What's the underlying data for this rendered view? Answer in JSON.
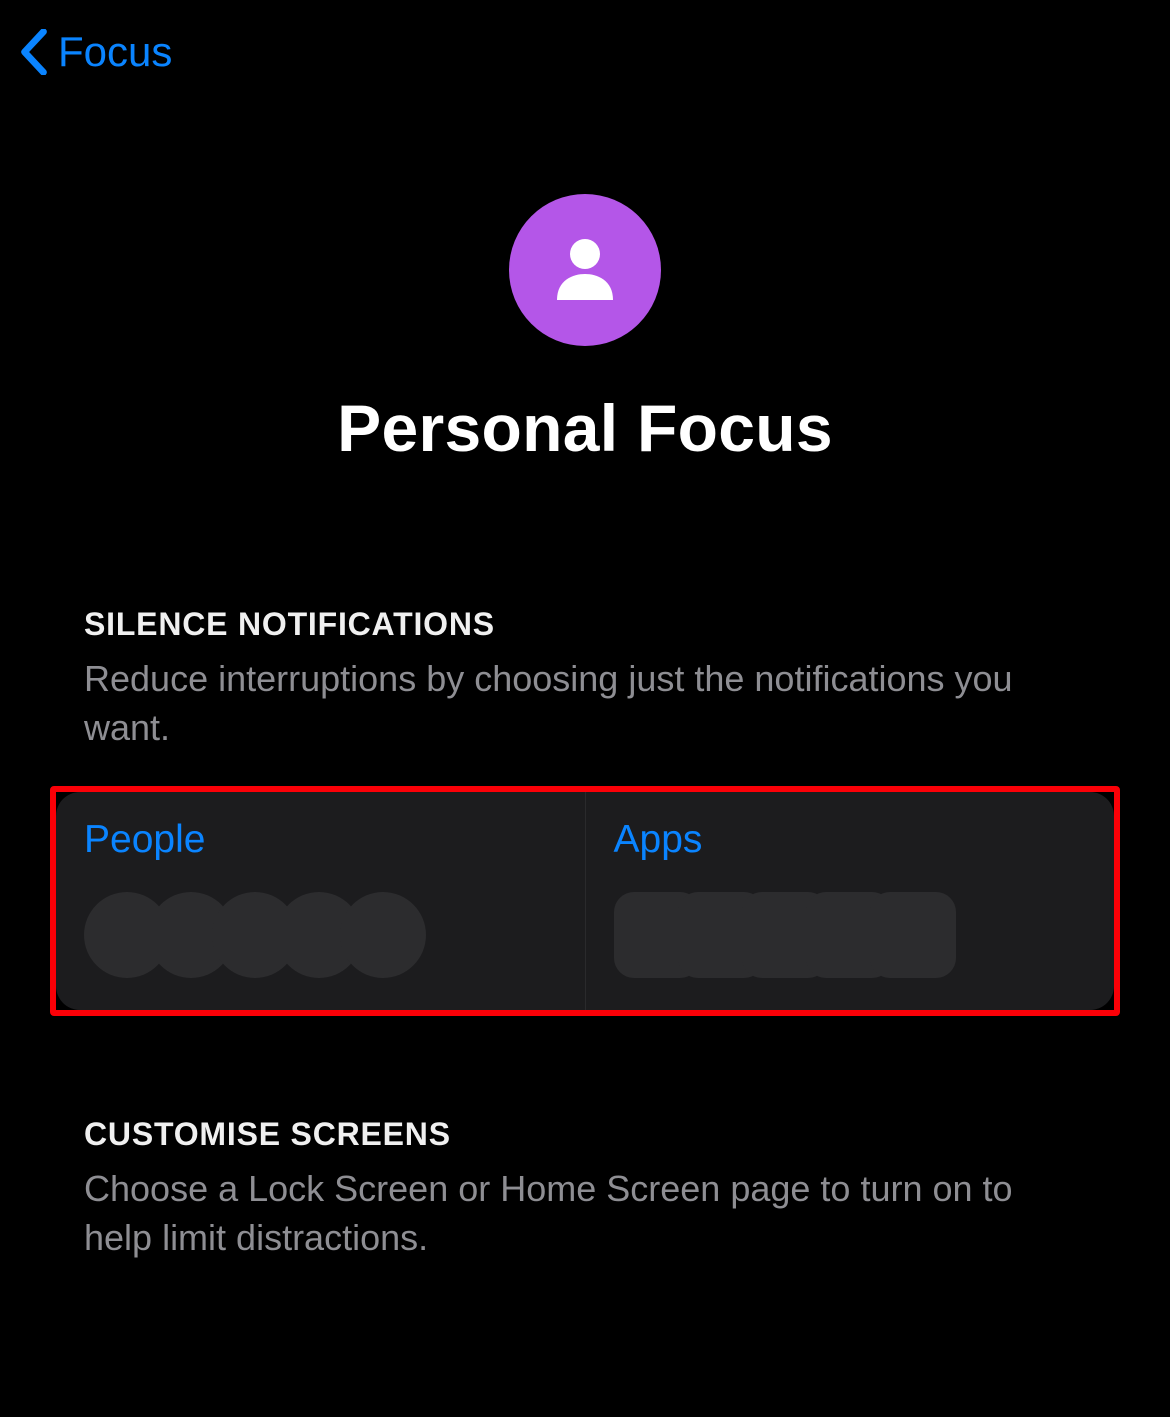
{
  "nav": {
    "back_label": "Focus"
  },
  "header": {
    "title": "Personal Focus",
    "icon": "person-icon",
    "icon_bg": "#b456e8"
  },
  "sections": {
    "silence": {
      "header": "SILENCE NOTIFICATIONS",
      "description": "Reduce interruptions by choosing just the notifications you want.",
      "cards": {
        "people": {
          "label": "People",
          "placeholder_count": 5
        },
        "apps": {
          "label": "Apps",
          "placeholder_count": 5
        }
      }
    },
    "customise": {
      "header": "CUSTOMISE SCREENS",
      "description": "Choose a Lock Screen or Home Screen page to turn on to help limit distractions."
    }
  },
  "colors": {
    "accent": "#0a84ff",
    "highlight_border": "#fb0007"
  }
}
